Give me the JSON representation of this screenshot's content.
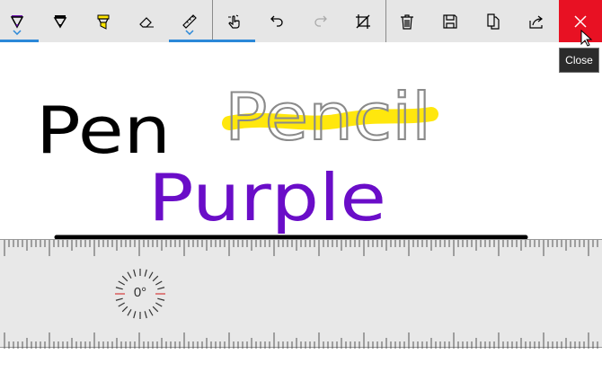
{
  "toolbar": {
    "buttons": [
      {
        "name": "ballpoint-pen",
        "icon": "pen-icon",
        "color": "#6a0dad"
      },
      {
        "name": "pencil",
        "icon": "pencil-icon",
        "color": "#000000"
      },
      {
        "name": "highlighter",
        "icon": "highlighter-icon",
        "color": "#ffe600"
      },
      {
        "name": "eraser",
        "icon": "eraser-icon"
      },
      {
        "name": "ruler",
        "icon": "ruler-icon"
      },
      {
        "name": "touch-writing",
        "icon": "touch-writing-icon"
      },
      {
        "name": "undo",
        "icon": "undo-icon"
      },
      {
        "name": "redo",
        "icon": "redo-icon"
      },
      {
        "name": "crop",
        "icon": "crop-icon"
      },
      {
        "name": "delete",
        "icon": "trash-icon"
      },
      {
        "name": "save",
        "icon": "save-icon"
      },
      {
        "name": "copy",
        "icon": "copy-icon"
      },
      {
        "name": "share",
        "icon": "share-icon"
      }
    ],
    "close_tooltip": "Close",
    "accent": "#2b88d8",
    "close_color": "#e81123"
  },
  "ruler": {
    "angle_label": "0°"
  },
  "ink": {
    "words": [
      "Pen",
      "Pencil",
      "Purple"
    ],
    "colors": {
      "pen": "#000000",
      "pencil": "#888888",
      "highlighter": "#ffe600",
      "purple": "#6a0dc8"
    }
  }
}
